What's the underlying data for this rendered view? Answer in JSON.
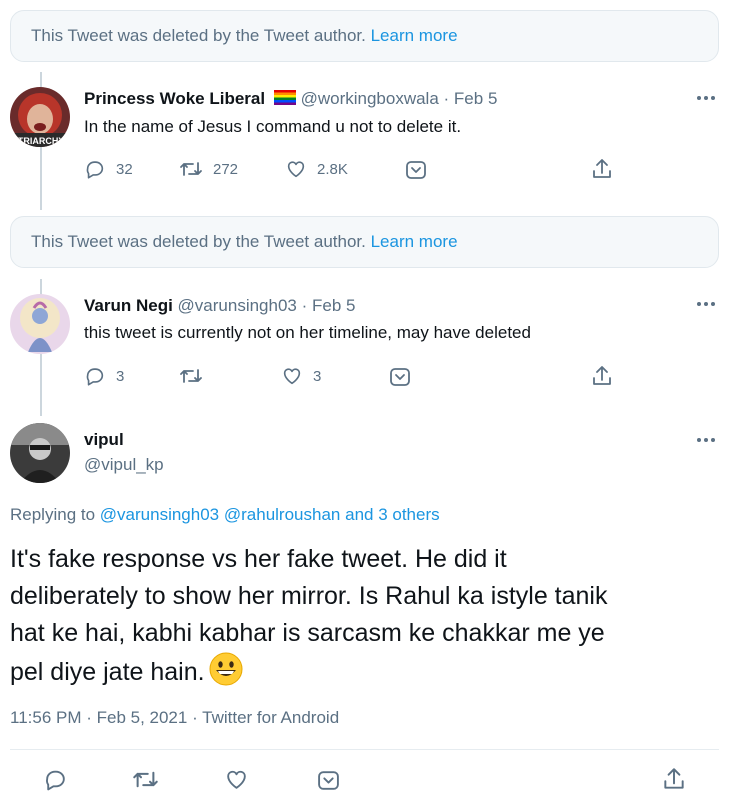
{
  "deleted_notice_1": {
    "text": "This Tweet was deleted by the Tweet author.",
    "link": "Learn more"
  },
  "tweet_1": {
    "name": "Princess Woke Liberal",
    "flag_icon": "rainbow-flag-icon",
    "handle": "@workingboxwala",
    "date": "Feb 5",
    "text": "In the name of Jesus I command u not to delete it.",
    "avatar_overlay": "ATRIARCHY",
    "replies": "32",
    "retweets": "272",
    "likes": "2.8K"
  },
  "deleted_notice_2": {
    "text": "This Tweet was deleted by the Tweet author.",
    "link": "Learn more"
  },
  "tweet_2": {
    "name": "Varun Negi",
    "handle": "@varunsingh03",
    "date": "Feb 5",
    "text": "this tweet is currently not on her timeline, may have deleted",
    "replies": "3",
    "likes": "3"
  },
  "main_tweet": {
    "name": "vipul",
    "handle": "@vipul_kp",
    "replying_prefix": "Replying to",
    "replying_to_1": "@varunsingh03",
    "replying_to_2": "@rahulroushan",
    "replying_others": "and 3 others",
    "line_1": "It's fake response vs her fake tweet. He did it",
    "line_2": "deliberately to show her mirror. Is Rahul ka istyle tanik",
    "line_3": "hat ke hai, kabhi kabhar is sarcasm ke chakkar me ye",
    "line_4": "pel diye jate hain.",
    "emoji": "grinning-face-emoji",
    "timestamp": "11:56 PM · Feb 5, 2021 · Twitter for Android"
  },
  "colors": {
    "accent": "#1b95e0",
    "muted": "#5b7083",
    "notice_bg": "#f5f8fa"
  },
  "icons": [
    "reply-icon",
    "retweet-icon",
    "like-icon",
    "tip-icon",
    "share-icon",
    "more-icon"
  ]
}
